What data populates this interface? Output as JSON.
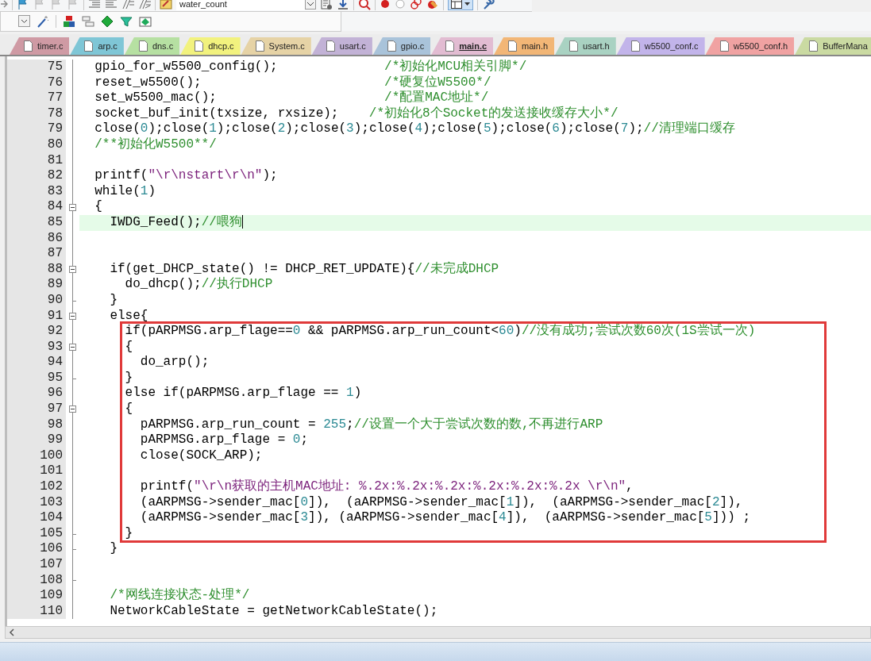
{
  "toolbar": {
    "target": "water_count"
  },
  "tabs": [
    {
      "label": "timer.c",
      "color": "#cf9aa4",
      "selected": false
    },
    {
      "label": "arp.c",
      "color": "#7fc6d6",
      "selected": false
    },
    {
      "label": "dns.c",
      "color": "#b6e0a2",
      "selected": false
    },
    {
      "label": "dhcp.c",
      "color": "#f2f27e",
      "selected": false
    },
    {
      "label": "System.c",
      "color": "#e6d3a6",
      "selected": false
    },
    {
      "label": "usart.c",
      "color": "#c2b2d6",
      "selected": false
    },
    {
      "label": "gpio.c",
      "color": "#a9c3da",
      "selected": false
    },
    {
      "label": "main.c",
      "color": "#e2bcd2",
      "selected": true
    },
    {
      "label": "main.h",
      "color": "#f2b676",
      "selected": false
    },
    {
      "label": "usart.h",
      "color": "#a9d2c2",
      "selected": false
    },
    {
      "label": "w5500_conf.c",
      "color": "#c2b4ea",
      "selected": false
    },
    {
      "label": "w5500_conf.h",
      "color": "#f0a2a2",
      "selected": false
    },
    {
      "label": "BufferMana",
      "color": "#cadaa2",
      "selected": false
    }
  ],
  "editor": {
    "blocks": [
      {
        "boxed": false,
        "lines": [
          {
            "number": "75",
            "kind": "plain",
            "current": false,
            "tokens": [
              {
                "kind": "code",
                "text": "  gpio_for_w5500_config();              "
              },
              {
                "kind": "comment",
                "text": "/*初始化MCU相关引脚*/"
              }
            ]
          },
          {
            "number": "76",
            "kind": "plain",
            "current": false,
            "tokens": [
              {
                "kind": "code",
                "text": "  reset_w5500();                        "
              },
              {
                "kind": "comment",
                "text": "/*硬复位W5500*/"
              }
            ]
          },
          {
            "number": "77",
            "kind": "plain",
            "current": false,
            "tokens": [
              {
                "kind": "code",
                "text": "  set_w5500_mac();                      "
              },
              {
                "kind": "comment",
                "text": "/*配置MAC地址*/"
              }
            ]
          },
          {
            "number": "78",
            "kind": "plain",
            "current": false,
            "tokens": [
              {
                "kind": "code",
                "text": "  socket_buf_init(txsize, rxsize);    "
              },
              {
                "kind": "comment",
                "text": "/*初始化8个Socket的发送接收缓存大小*/"
              }
            ]
          },
          {
            "number": "79",
            "kind": "plain",
            "current": false,
            "tokens": [
              {
                "kind": "code",
                "text": "  close("
              },
              {
                "kind": "number",
                "text": "0"
              },
              {
                "kind": "code",
                "text": ");close("
              },
              {
                "kind": "number",
                "text": "1"
              },
              {
                "kind": "code",
                "text": ");close("
              },
              {
                "kind": "number",
                "text": "2"
              },
              {
                "kind": "code",
                "text": ");close("
              },
              {
                "kind": "number",
                "text": "3"
              },
              {
                "kind": "code",
                "text": ");close("
              },
              {
                "kind": "number",
                "text": "4"
              },
              {
                "kind": "code",
                "text": ");close("
              },
              {
                "kind": "number",
                "text": "5"
              },
              {
                "kind": "code",
                "text": ");close("
              },
              {
                "kind": "number",
                "text": "6"
              },
              {
                "kind": "code",
                "text": ");close("
              },
              {
                "kind": "number",
                "text": "7"
              },
              {
                "kind": "code",
                "text": ");"
              },
              {
                "kind": "comment",
                "text": "//清理端口缓存"
              }
            ]
          },
          {
            "number": "80",
            "kind": "plain",
            "current": false,
            "tokens": [
              {
                "kind": "comment",
                "text": "  /**初始化W5500**/"
              }
            ]
          },
          {
            "number": "81",
            "kind": "plain",
            "current": false
          },
          {
            "number": "82",
            "kind": "plain",
            "current": false,
            "tokens": [
              {
                "kind": "code",
                "text": "  printf("
              },
              {
                "kind": "string",
                "text": "\"\\r\\nstart\\r\\n\""
              },
              {
                "kind": "code",
                "text": ");"
              }
            ]
          },
          {
            "number": "83",
            "kind": "plain",
            "current": false,
            "tokens": [
              {
                "kind": "code",
                "text": "  while("
              },
              {
                "kind": "number",
                "text": "1"
              },
              {
                "kind": "code",
                "text": ")"
              }
            ]
          },
          {
            "number": "84",
            "kind": "opener",
            "current": false,
            "tokens": [
              {
                "kind": "code",
                "text": "  {"
              }
            ]
          },
          {
            "number": "85",
            "kind": "plain",
            "current": true,
            "tokens": [
              {
                "kind": "code",
                "text": "    IWDG_Feed();"
              },
              {
                "kind": "comment",
                "text": "//喂狗"
              }
            ]
          },
          {
            "number": "86",
            "kind": "plain",
            "current": false
          },
          {
            "number": "87",
            "kind": "plain",
            "current": false
          },
          {
            "number": "88",
            "kind": "opener",
            "current": false,
            "tokens": [
              {
                "kind": "code",
                "text": "    if(get_DHCP_state() != DHCP_RET_UPDATE){"
              },
              {
                "kind": "comment",
                "text": "//未完成DHCP"
              }
            ]
          },
          {
            "number": "89",
            "kind": "plain",
            "current": false,
            "tokens": [
              {
                "kind": "code",
                "text": "      do_dhcp();"
              },
              {
                "kind": "comment",
                "text": "//执行DHCP"
              }
            ]
          },
          {
            "number": "90",
            "kind": "closer",
            "current": false,
            "tokens": [
              {
                "kind": "code",
                "text": "    }"
              }
            ]
          },
          {
            "number": "91",
            "kind": "opener",
            "current": false,
            "tokens": [
              {
                "kind": "code",
                "text": "    else{"
              }
            ]
          }
        ]
      },
      {
        "boxed": true,
        "lines": [
          {
            "number": "92",
            "kind": "plain",
            "current": false,
            "tokens": [
              {
                "kind": "code",
                "text": "      if(pARPMSG.arp_flage=="
              },
              {
                "kind": "number",
                "text": "0"
              },
              {
                "kind": "code",
                "text": " && pARPMSG.arp_run_count<"
              },
              {
                "kind": "number",
                "text": "60"
              },
              {
                "kind": "code",
                "text": ")"
              },
              {
                "kind": "comment",
                "text": "//没有成功;尝试次数60次(1S尝试一次)"
              }
            ]
          },
          {
            "number": "93",
            "kind": "opener",
            "current": false,
            "tokens": [
              {
                "kind": "code",
                "text": "      {"
              }
            ]
          },
          {
            "number": "94",
            "kind": "plain",
            "current": false,
            "tokens": [
              {
                "kind": "code",
                "text": "        do_arp();"
              }
            ]
          },
          {
            "number": "95",
            "kind": "closer",
            "current": false,
            "tokens": [
              {
                "kind": "code",
                "text": "      }"
              }
            ]
          },
          {
            "number": "96",
            "kind": "plain",
            "current": false,
            "tokens": [
              {
                "kind": "code",
                "text": "      else if(pARPMSG.arp_flage == "
              },
              {
                "kind": "number",
                "text": "1"
              },
              {
                "kind": "code",
                "text": ")"
              }
            ]
          },
          {
            "number": "97",
            "kind": "opener",
            "current": false,
            "tokens": [
              {
                "kind": "code",
                "text": "      {"
              }
            ]
          },
          {
            "number": "98",
            "kind": "plain",
            "current": false,
            "tokens": [
              {
                "kind": "code",
                "text": "        pARPMSG.arp_run_count = "
              },
              {
                "kind": "number",
                "text": "255"
              },
              {
                "kind": "code",
                "text": ";"
              },
              {
                "kind": "comment",
                "text": "//设置一个大于尝试次数的数,不再进行ARP"
              }
            ]
          },
          {
            "number": "99",
            "kind": "plain",
            "current": false,
            "tokens": [
              {
                "kind": "code",
                "text": "        pARPMSG.arp_flage = "
              },
              {
                "kind": "number",
                "text": "0"
              },
              {
                "kind": "code",
                "text": ";"
              }
            ]
          },
          {
            "number": "100",
            "kind": "plain",
            "current": false,
            "tokens": [
              {
                "kind": "code",
                "text": "        close(SOCK_ARP);"
              }
            ]
          },
          {
            "number": "101",
            "kind": "plain",
            "current": false
          },
          {
            "number": "102",
            "kind": "plain",
            "current": false,
            "tokens": [
              {
                "kind": "code",
                "text": "        printf("
              },
              {
                "kind": "string",
                "text": "\"\\r\\n获取的主机MAC地址: %.2x:%.2x:%.2x:%.2x:%.2x:%.2x \\r\\n\""
              },
              {
                "kind": "code",
                "text": ","
              }
            ]
          },
          {
            "number": "103",
            "kind": "plain",
            "current": false,
            "tokens": [
              {
                "kind": "code",
                "text": "        (aARPMSG->sender_mac["
              },
              {
                "kind": "number",
                "text": "0"
              },
              {
                "kind": "code",
                "text": "]),  (aARPMSG->sender_mac["
              },
              {
                "kind": "number",
                "text": "1"
              },
              {
                "kind": "code",
                "text": "]),  (aARPMSG->sender_mac["
              },
              {
                "kind": "number",
                "text": "2"
              },
              {
                "kind": "code",
                "text": "]),"
              }
            ]
          },
          {
            "number": "104",
            "kind": "plain",
            "current": false,
            "tokens": [
              {
                "kind": "code",
                "text": "        (aARPMSG->sender_mac["
              },
              {
                "kind": "number",
                "text": "3"
              },
              {
                "kind": "code",
                "text": "]), (aARPMSG->sender_mac["
              },
              {
                "kind": "number",
                "text": "4"
              },
              {
                "kind": "code",
                "text": "]),  (aARPMSG->sender_mac["
              },
              {
                "kind": "number",
                "text": "5"
              },
              {
                "kind": "code",
                "text": "])) ;"
              }
            ]
          },
          {
            "number": "105",
            "kind": "closer",
            "current": false,
            "tokens": [
              {
                "kind": "code",
                "text": "      }"
              }
            ]
          }
        ]
      },
      {
        "boxed": false,
        "lines": [
          {
            "number": "106",
            "kind": "closer",
            "current": false,
            "tokens": [
              {
                "kind": "code",
                "text": "    }"
              }
            ]
          },
          {
            "number": "107",
            "kind": "plain",
            "current": false
          },
          {
            "number": "108",
            "kind": "closer",
            "current": false
          },
          {
            "number": "109",
            "kind": "plain",
            "current": false,
            "tokens": [
              {
                "kind": "comment",
                "text": "    /*网线连接状态-处理*/"
              }
            ]
          },
          {
            "number": "110",
            "kind": "plain",
            "current": false,
            "tokens": [
              {
                "kind": "code",
                "text": "    NetworkCableState = getNetworkCableState();"
              }
            ]
          }
        ]
      }
    ]
  }
}
